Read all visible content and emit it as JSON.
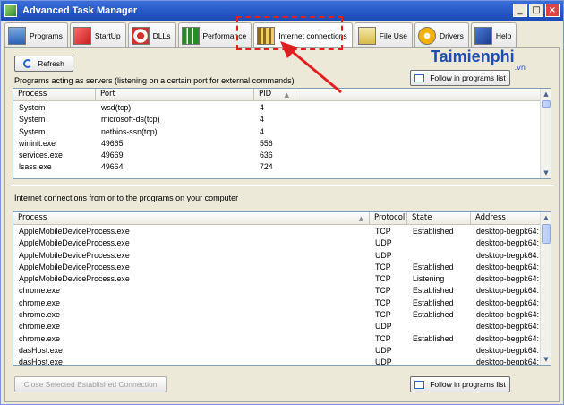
{
  "window": {
    "title": "Advanced Task Manager",
    "controls": [
      "_",
      "□",
      "×"
    ]
  },
  "tabs": [
    {
      "label": "Programs",
      "icon": "programs-icon"
    },
    {
      "label": "StartUp",
      "icon": "startup-icon"
    },
    {
      "label": "DLLs",
      "icon": "dlls-icon"
    },
    {
      "label": "Performance",
      "icon": "performance-icon"
    },
    {
      "label": "Internet connections",
      "icon": "internet-connections-icon",
      "active": true
    },
    {
      "label": "File Use",
      "icon": "file-use-icon"
    },
    {
      "label": "Drivers",
      "icon": "drivers-icon"
    },
    {
      "label": "Help",
      "icon": "help-icon"
    }
  ],
  "toolbar": {
    "refresh_label": "Refresh",
    "follow_label": "Follow in programs list"
  },
  "brand": {
    "name": "Taimienphi",
    "suffix": ".vn"
  },
  "servers": {
    "label": "Programs acting as servers (listening on a certain port for external commands)",
    "columns": [
      "Process",
      "Port",
      "PID"
    ],
    "rows": [
      [
        "System",
        "wsd(tcp)",
        "4"
      ],
      [
        "System",
        "microsoft-ds(tcp)",
        "4"
      ],
      [
        "System",
        "netbios-ssn(tcp)",
        "4"
      ],
      [
        "wininit.exe",
        "49665",
        "556"
      ],
      [
        "services.exe",
        "49669",
        "636"
      ],
      [
        "lsass.exe",
        "49664",
        "724"
      ]
    ]
  },
  "connections": {
    "label": "Internet connections from or to the programs on your computer",
    "columns": [
      "Process",
      "Protocol",
      "State",
      "Address"
    ],
    "rows": [
      [
        "AppleMobileDeviceProcess.exe",
        "TCP",
        "Established",
        "desktop-begpk64:"
      ],
      [
        "AppleMobileDeviceProcess.exe",
        "UDP",
        "",
        "desktop-begpk64:"
      ],
      [
        "AppleMobileDeviceProcess.exe",
        "UDP",
        "",
        "desktop-begpk64:"
      ],
      [
        "AppleMobileDeviceProcess.exe",
        "TCP",
        "Established",
        "desktop-begpk64:"
      ],
      [
        "AppleMobileDeviceProcess.exe",
        "TCP",
        "Listening",
        "desktop-begpk64:"
      ],
      [
        "chrome.exe",
        "TCP",
        "Established",
        "desktop-begpk64:"
      ],
      [
        "chrome.exe",
        "TCP",
        "Established",
        "desktop-begpk64:"
      ],
      [
        "chrome.exe",
        "TCP",
        "Established",
        "desktop-begpk64:"
      ],
      [
        "chrome.exe",
        "UDP",
        "",
        "desktop-begpk64:"
      ],
      [
        "chrome.exe",
        "TCP",
        "Established",
        "desktop-begpk64:"
      ],
      [
        "dasHost.exe",
        "UDP",
        "",
        "desktop-begpk64:"
      ],
      [
        "dasHost.exe",
        "UDP",
        "",
        "desktop-begpk64:"
      ]
    ]
  },
  "bottom": {
    "close_label": "Close Selected Established Connection",
    "follow_label": "Follow in programs list"
  },
  "colors": {
    "highlight": "#e02020",
    "titlebar": "#2456c4",
    "brand": "#1e4fb0"
  }
}
